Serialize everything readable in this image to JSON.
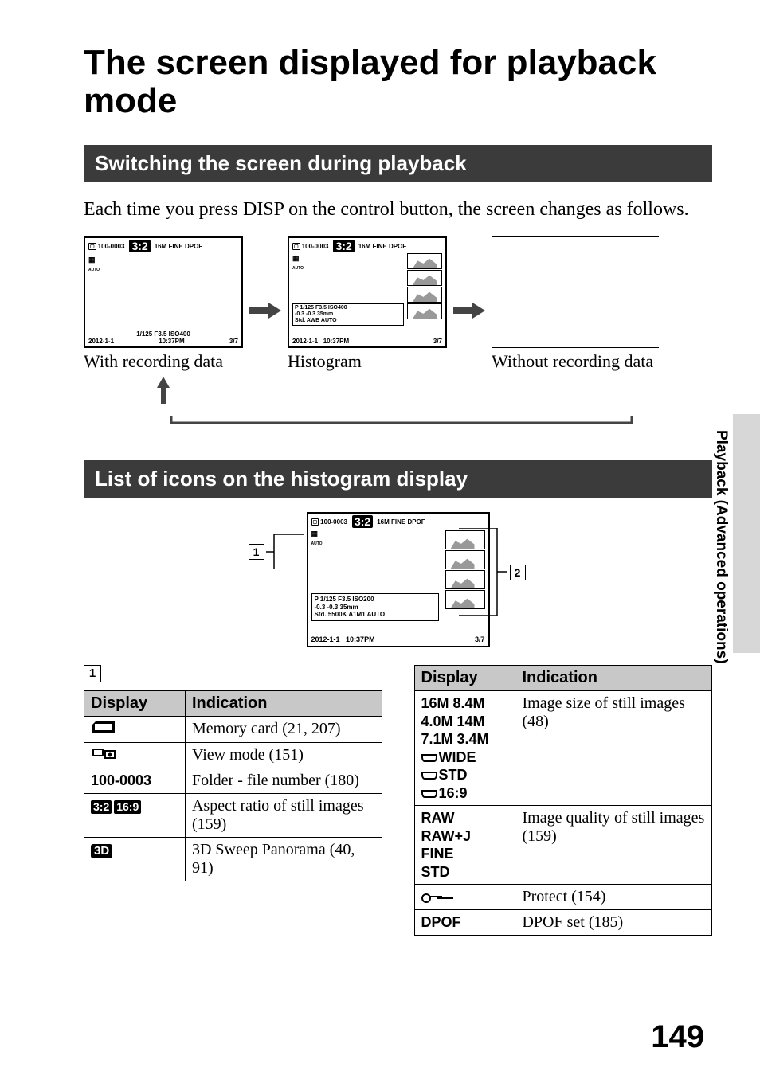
{
  "title": "The screen displayed for playback mode",
  "section1": "Switching the screen during playback",
  "intro": "Each time you press DISP on the control button, the screen changes as follows.",
  "screens": {
    "s1_caption": "With recording data",
    "s2_caption": "Histogram",
    "s3_caption": "Without recording data",
    "top_line": "100-0003",
    "top_right": "16M  FINE        DPOF",
    "ratio_badge": "3:2",
    "s1_bottom_date": "2012-1-1",
    "s1_bottom_mid": "1/125    F3.5    ISO400",
    "s1_bottom_time": "10:37PM",
    "s1_counter": "3/7",
    "s2_line1": "P    1/125    F3.5    ISO400",
    "s2_line2": "-0.3     -0.3            35mm",
    "s2_line3": "Std.            AWB        AUTO",
    "histo_line1": "P    1/125    F3.5    ISO200",
    "histo_line2": "-0.3     -0.3            35mm",
    "histo_line3": "Std.       5500K A1M1      AUTO"
  },
  "section2": "List of icons on the histogram display",
  "callout1": "1",
  "callout2": "2",
  "table_headers": {
    "display": "Display",
    "indication": "Indication"
  },
  "table1": [
    {
      "disp_icon": "card",
      "ind": "Memory card (21, 207)"
    },
    {
      "disp_icon": "viewmode",
      "ind": "View mode (151)"
    },
    {
      "disp_text": "100-0003",
      "ind": "Folder - file number (180)"
    },
    {
      "disp_icon": "ratios",
      "ind": "Aspect ratio of still images (159)"
    },
    {
      "disp_icon": "3d",
      "ind": "3D Sweep Panorama (40, 91)"
    }
  ],
  "table2": [
    {
      "disp_text": "16M 8.4M\n4.0M 14M\n7.1M 3.4M",
      "disp_extra": [
        "WIDE",
        "STD",
        "16:9"
      ],
      "ind": "Image size of still images (48)"
    },
    {
      "disp_text": "RAW\nRAW+J\nFINE\nSTD",
      "ind": "Image quality of still images (159)"
    },
    {
      "disp_icon": "key",
      "ind": "Protect (154)"
    },
    {
      "disp_text": "DPOF",
      "ind": "DPOF set (185)"
    }
  ],
  "side_label": "Playback (Advanced operations)",
  "page_number": "149"
}
